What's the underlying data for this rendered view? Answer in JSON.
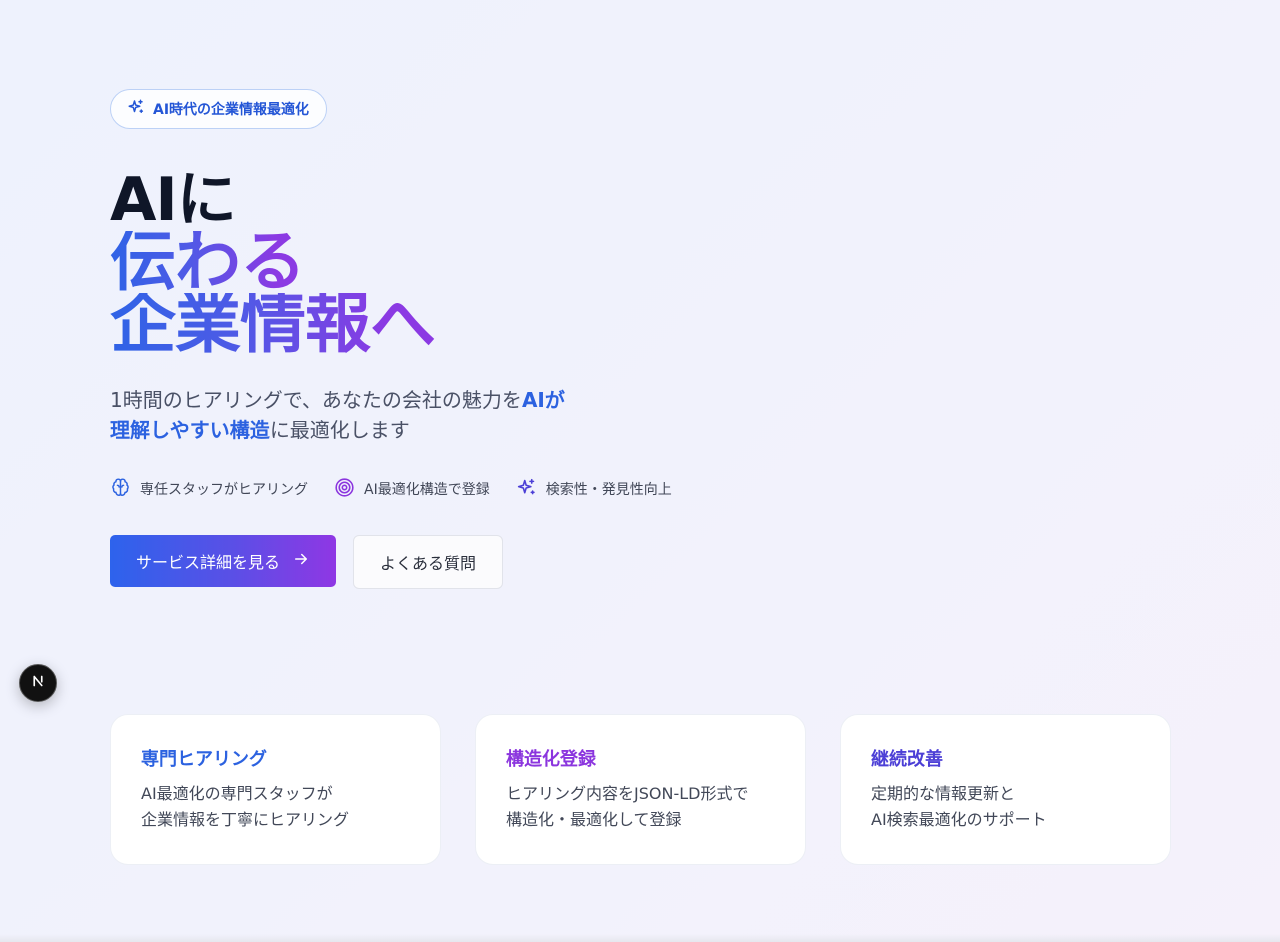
{
  "badge": {
    "label": "AI時代の企業情報最適化",
    "icon": "sparkles-icon"
  },
  "headline": {
    "line1": "AIに",
    "line2": "伝わる",
    "line3": "企業情報へ"
  },
  "subtitle": {
    "part1": "1時間のヒアリングで、あなたの会社の魅力を",
    "highlight": "AIが理解しやすい構造",
    "part2": "に最適化します"
  },
  "features": [
    {
      "icon": "brain-icon",
      "label": "専任スタッフがヒアリング"
    },
    {
      "icon": "target-icon",
      "label": "AI最適化構造で登録"
    },
    {
      "icon": "sparkles-icon",
      "label": "検索性・発見性向上"
    }
  ],
  "buttons": {
    "primary": "サービス詳細を見る",
    "secondary": "よくある質問"
  },
  "cards": [
    {
      "title": "専門ヒアリング",
      "text": "AI最適化の専門スタッフが\n企業情報を丁寧にヒアリング",
      "color": "#2c62e0"
    },
    {
      "title": "構造化登録",
      "text": "ヒアリング内容をJSON-LD形式で\n構造化・最適化して登録",
      "color": "#8b35de"
    },
    {
      "title": "継続改善",
      "text": "定期的な情報更新と\nAI検索最適化のサポート",
      "color": "#4c3fd6"
    }
  ],
  "colors": {
    "accent_blue": "#2c62e0",
    "accent_purple": "#8b35de",
    "indigo": "#4c3fd6"
  }
}
